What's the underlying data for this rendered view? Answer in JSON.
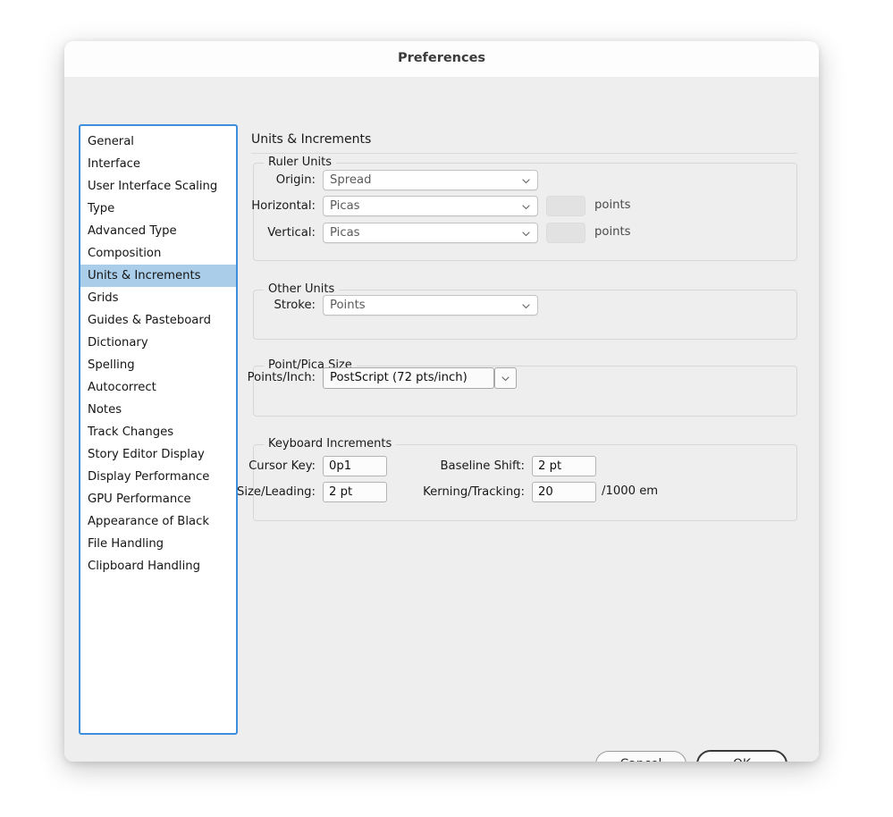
{
  "window": {
    "title": "Preferences"
  },
  "sidebar": {
    "items": [
      {
        "label": "General",
        "selected": false
      },
      {
        "label": "Interface",
        "selected": false
      },
      {
        "label": "User Interface Scaling",
        "selected": false
      },
      {
        "label": "Type",
        "selected": false
      },
      {
        "label": "Advanced Type",
        "selected": false
      },
      {
        "label": "Composition",
        "selected": false
      },
      {
        "label": "Units & Increments",
        "selected": true
      },
      {
        "label": "Grids",
        "selected": false
      },
      {
        "label": "Guides & Pasteboard",
        "selected": false
      },
      {
        "label": "Dictionary",
        "selected": false
      },
      {
        "label": "Spelling",
        "selected": false
      },
      {
        "label": "Autocorrect",
        "selected": false
      },
      {
        "label": "Notes",
        "selected": false
      },
      {
        "label": "Track Changes",
        "selected": false
      },
      {
        "label": "Story Editor Display",
        "selected": false
      },
      {
        "label": "Display Performance",
        "selected": false
      },
      {
        "label": "GPU Performance",
        "selected": false
      },
      {
        "label": "Appearance of Black",
        "selected": false
      },
      {
        "label": "File Handling",
        "selected": false
      },
      {
        "label": "Clipboard Handling",
        "selected": false
      }
    ]
  },
  "panel": {
    "title": "Units & Increments",
    "ruler_units": {
      "legend": "Ruler Units",
      "origin_label": "Origin:",
      "origin_value": "Spread",
      "horizontal_label": "Horizontal:",
      "horizontal_value": "Picas",
      "horizontal_points_value": "",
      "horizontal_points_unit": "points",
      "vertical_label": "Vertical:",
      "vertical_value": "Picas",
      "vertical_points_value": "",
      "vertical_points_unit": "points"
    },
    "other_units": {
      "legend": "Other Units",
      "stroke_label": "Stroke:",
      "stroke_value": "Points"
    },
    "point_pica_size": {
      "legend": "Point/Pica Size",
      "points_inch_label": "Points/Inch:",
      "points_inch_value": "PostScript (72 pts/inch)"
    },
    "keyboard_increments": {
      "legend": "Keyboard Increments",
      "cursor_key_label": "Cursor Key:",
      "cursor_key_value": "0p1",
      "size_leading_label": "Size/Leading:",
      "size_leading_value": "2 pt",
      "baseline_shift_label": "Baseline Shift:",
      "baseline_shift_value": "2 pt",
      "kerning_tracking_label": "Kerning/Tracking:",
      "kerning_tracking_value": "20",
      "kerning_tracking_unit": "/1000 em"
    }
  },
  "footer": {
    "cancel_label": "Cancel",
    "ok_label": "OK"
  },
  "colors": {
    "selection_blue": "#aacdea",
    "focus_ring_blue": "#3e8ede",
    "dialog_background": "#eeeeee",
    "titlebar_background": "#fdfdfd"
  }
}
